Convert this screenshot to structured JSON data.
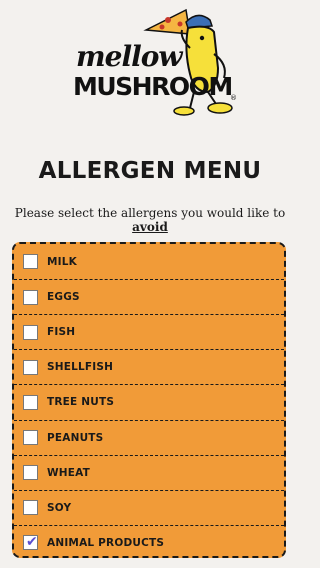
{
  "brand": {
    "logo_line1": "mellow",
    "logo_line2": "MUSHROOM",
    "trademark": "®"
  },
  "header": {
    "title": "ALLERGEN MENU",
    "prompt_prefix": "Please select the allergens you would like to",
    "prompt_emphasis": "avoid"
  },
  "allergens": [
    {
      "label": "MILK",
      "checked": false
    },
    {
      "label": "EGGS",
      "checked": false
    },
    {
      "label": "FISH",
      "checked": false
    },
    {
      "label": "SHELLFISH",
      "checked": false
    },
    {
      "label": "TREE NUTS",
      "checked": false
    },
    {
      "label": "PEANUTS",
      "checked": false
    },
    {
      "label": "WHEAT",
      "checked": false
    },
    {
      "label": "SOY",
      "checked": false
    },
    {
      "label": "ANIMAL PRODUCTS",
      "checked": true
    }
  ],
  "colors": {
    "panel": "#f19b38",
    "background": "#f3f1ee",
    "check": "#5b4fd0"
  }
}
